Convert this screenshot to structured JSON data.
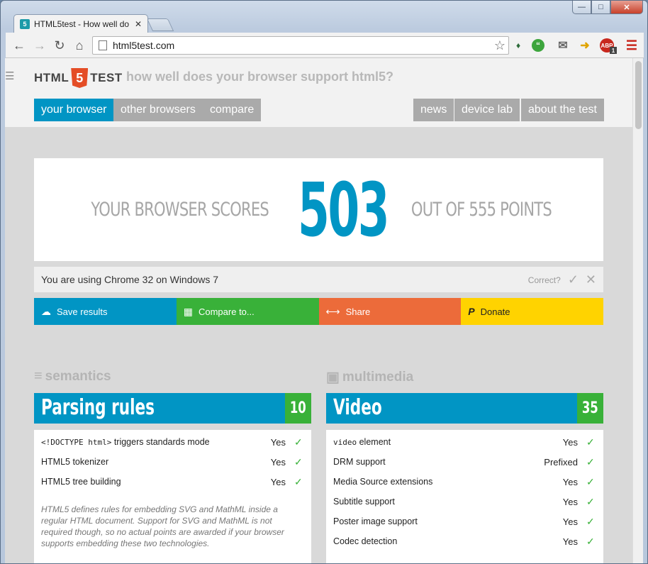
{
  "browser": {
    "tab_title": "HTML5test - How well do",
    "favicon_text": "5",
    "url": "html5test.com",
    "ext_abp_badge": "1"
  },
  "site": {
    "logo_left": "HTML",
    "logo_mid": "5",
    "logo_right": "TEST",
    "tagline": "how well does your browser support html5?",
    "nav_left": [
      "your browser",
      "other browsers",
      "compare"
    ],
    "nav_right": [
      "news",
      "device lab",
      "about the test"
    ]
  },
  "score": {
    "prefix": "YOUR BROWSER SCORES",
    "value": "503",
    "suffix": "OUT OF 555 POINTS"
  },
  "using": {
    "text": "You are using Chrome 32 on Windows 7",
    "correct_label": "Correct?"
  },
  "actions": [
    "Save results",
    "Compare to...",
    "Share",
    "Donate"
  ],
  "sections": {
    "left_title": "semantics",
    "right_title": "multimedia"
  },
  "left_category": {
    "name": "Parsing rules",
    "score": "10",
    "rows": [
      {
        "code": "<!DOCTYPE html>",
        "label": " triggers standards mode",
        "value": "Yes"
      },
      {
        "code": "",
        "label": "HTML5 tokenizer",
        "value": "Yes"
      },
      {
        "code": "",
        "label": "HTML5 tree building",
        "value": "Yes"
      }
    ],
    "note": "HTML5 defines rules for embedding SVG and MathML inside a regular HTML document. Support for SVG and MathML is not required though, so no actual points are awarded if your browser supports embedding these two technologies."
  },
  "right_category": {
    "name": "Video",
    "score": "35",
    "rows": [
      {
        "code": "video",
        "label": " element",
        "value": "Yes"
      },
      {
        "code": "",
        "label": "DRM support",
        "value": "Prefixed"
      },
      {
        "code": "",
        "label": "Media Source extensions",
        "value": "Yes"
      },
      {
        "code": "",
        "label": "Subtitle support",
        "value": "Yes"
      },
      {
        "code": "",
        "label": "Poster image support",
        "value": "Yes"
      },
      {
        "code": "",
        "label": "Codec detection",
        "value": "Yes"
      }
    ]
  },
  "colors": {
    "accent_blue": "#0195c4",
    "green": "#39b139",
    "orange": "#ec6b3a",
    "yellow": "#ffd300",
    "gray_nav": "#aaaaaa"
  }
}
